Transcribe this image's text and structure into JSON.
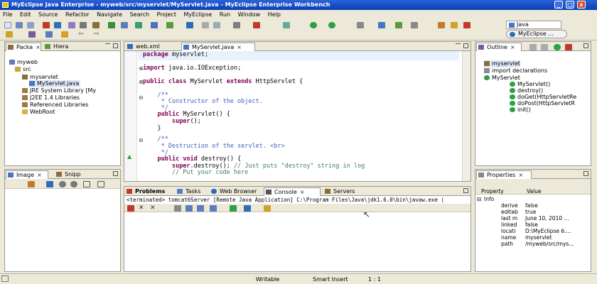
{
  "window": {
    "title": "MyEclipse Java Enterprise - myweb/src/myservlet/MyServlet.java - MyEclipse Enterprise Workbench"
  },
  "menu": [
    "File",
    "Edit",
    "Source",
    "Refactor",
    "Navigate",
    "Search",
    "Project",
    "MyEclipse",
    "Run",
    "Window",
    "Help"
  ],
  "perspectives": {
    "java": "Java",
    "myeclipse": "MyEclipse ..."
  },
  "left_top": {
    "tabs": [
      "Packa",
      "Hiera"
    ],
    "tree": [
      "myweb",
      "src",
      "myservlet",
      "MyServlet.java",
      "JRE System Library [My",
      "J2EE 1.4 Libraries",
      "Referenced Libraries",
      "WebRoot"
    ]
  },
  "left_bottom": {
    "tabs": [
      "Image",
      "Snipp"
    ]
  },
  "editor": {
    "tabs": [
      "web.xml",
      "MyServlet.java"
    ],
    "lines": [
      "package myservlet;",
      "",
      "import java.io.IOException;",
      "",
      "public class MyServlet extends HttpServlet {",
      "",
      "    /**",
      "     * Constructor of the object.",
      "     */",
      "    public MyServlet() {",
      "        super();",
      "    }",
      "",
      "    /**",
      "     * Destruction of the servlet. <br>",
      "     */",
      "    public void destroy() {",
      "        super.destroy(); // Just puts \"destroy\" string in log",
      "        // Put your code here"
    ]
  },
  "outline": {
    "tab": "Outline",
    "items": [
      "myservlet",
      "import declarations",
      "MyServlet",
      "MyServlet()",
      "destroy()",
      "doGet(HttpServletRe",
      "doPost(HttpServletR",
      "init()"
    ]
  },
  "bottom": {
    "tabs": [
      "Problems",
      "Tasks",
      "Web Browser",
      "Console",
      "Servers"
    ],
    "console_header": "<terminated> tomcat6Server [Remote Java Application] C:\\Program Files\\Java\\jdk1.6.0\\bin\\javaw.exe ("
  },
  "properties": {
    "tab": "Properties",
    "headers": [
      "Property",
      "Value"
    ],
    "group": "Info",
    "rows": [
      [
        "derive",
        "false"
      ],
      [
        "editab",
        "true"
      ],
      [
        "last m",
        "June 10, 2010 ..."
      ],
      [
        "linked",
        "false"
      ],
      [
        "locati",
        "D:\\MyEclipse 6...."
      ],
      [
        "name",
        "myservlet"
      ],
      [
        "path",
        "/myweb/src/mys..."
      ]
    ]
  },
  "status": {
    "writable": "Writable",
    "insert": "Smart Insert",
    "position": "1 : 1"
  }
}
